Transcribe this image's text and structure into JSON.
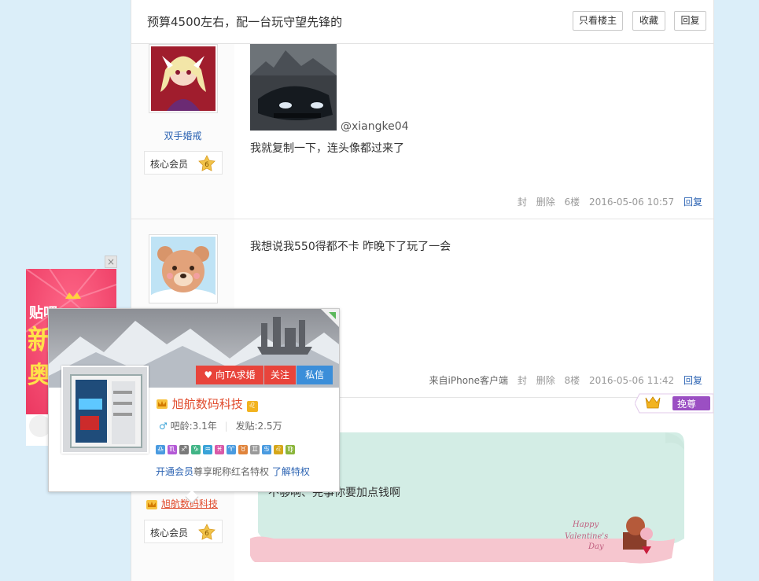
{
  "header": {
    "title": "预算4500左右，配一台玩守望先锋的",
    "btn_louzhu": "只看楼主",
    "btn_fav": "收藏",
    "btn_reply": "回复"
  },
  "post1": {
    "username": "双手婚戒",
    "badge": "核心会员",
    "level": "6",
    "mention": "@xiangke04",
    "text": "我就复制一下，连头像都过来了",
    "meta": {
      "ban": "封",
      "del": "删除",
      "floor": "6楼",
      "time": "2016-05-06 10:57",
      "reply": "回复"
    }
  },
  "post2": {
    "text": "我想说我550得都不卡 昨晚下了玩了一会",
    "meta": {
      "source": "来自iPhone客户端",
      "ban": "封",
      "del": "删除",
      "floor": "8楼",
      "time": "2016-05-06 11:42",
      "reply": "回复"
    }
  },
  "post3": {
    "username": "旭航数码科技",
    "badge": "核心会员",
    "level": "6",
    "text": "不够啊、完事你要加点钱啊",
    "crown_label": "挽尊"
  },
  "card": {
    "btn_marry": "向TA求婚",
    "btn_follow": "关注",
    "btn_pm": "私信",
    "name": "旭航数码科技",
    "age_label": "吧龄:3.1年",
    "posts_label": "发贴:2.5万",
    "zodiac": [
      "♎",
      "♏",
      "♐",
      "♑",
      "♒",
      "♓",
      "♈",
      "♉",
      "♊",
      "♋",
      "♌",
      "♍"
    ],
    "zodiac_colors": [
      "#4a9be0",
      "#b45ad6",
      "#7a7a7a",
      "#41b486",
      "#3aa3d8",
      "#d95aa8",
      "#4a9be0",
      "#e0843c",
      "#9a9a9a",
      "#4a9be0",
      "#d6a71a",
      "#8ab53a"
    ],
    "foot_a": "开通会员",
    "foot_b": "尊享昵称红名特权",
    "foot_link": "了解特权"
  },
  "ad": {
    "line1": "贴吧",
    "line2": "新",
    "line3": "奥"
  },
  "colors": {
    "link": "#2d64b3",
    "red": "#e04a2b",
    "brand_blue": "#2d64b3"
  }
}
